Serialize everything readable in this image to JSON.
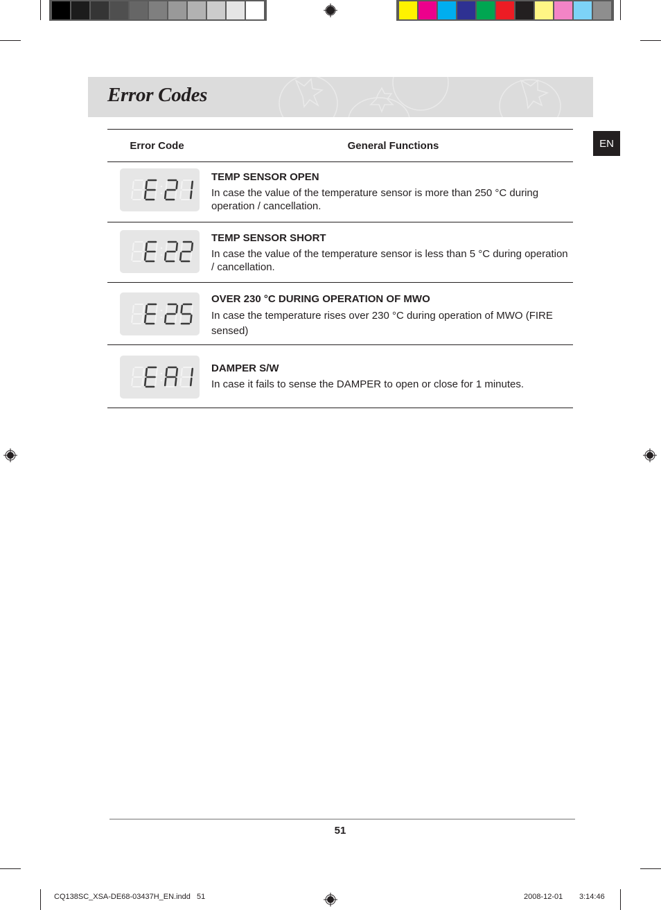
{
  "print_marks": {
    "gray_swatches": [
      "#000000",
      "#1c1c1c",
      "#353535",
      "#4f4f4f",
      "#666666",
      "#7f7f7f",
      "#999999",
      "#b2b2b2",
      "#cccccc",
      "#e5e5e5",
      "#ffffff"
    ],
    "color_swatches": [
      "#fff200",
      "#ec008c",
      "#00aeef",
      "#2e3192",
      "#00a651",
      "#ed1c24",
      "#231f20",
      "#fff685",
      "#f384c6",
      "#7dd3f7",
      "#8e8e8e"
    ]
  },
  "header": {
    "title": "Error Codes"
  },
  "language_tab": "EN",
  "table": {
    "columns": {
      "code": "Error Code",
      "functions": "General Functions"
    },
    "rows": [
      {
        "code": "E 21",
        "display_digits": [
          "E",
          "2",
          "1"
        ],
        "title": "TEMP SENSOR OPEN",
        "description": "In case the value of the temperature sensor is more than 250 °C during operation / cancellation."
      },
      {
        "code": "E 22",
        "display_digits": [
          "E",
          "2",
          "2"
        ],
        "title": "TEMP SENSOR SHORT",
        "description": "In case the value of the temperature sensor is less than 5 °C during operation / cancellation."
      },
      {
        "code": "E 25",
        "display_digits": [
          "E",
          "2",
          "5"
        ],
        "title": "OVER 230 °C DURING OPERATION OF MWO",
        "description": "In case the temperature rises over 230 °C during operation of MWO (FIRE sensed)"
      },
      {
        "code": "E A1",
        "display_digits": [
          "E",
          "A",
          "1"
        ],
        "title": "DAMPER S/W",
        "description": "In case it fails to sense the DAMPER to open or close for 1 minutes."
      }
    ]
  },
  "footer": {
    "page_number": "51",
    "slug_file": "CQ138SC_XSA-DE68-03437H_EN.indd   51",
    "slug_date": "2008-12-01",
    "slug_time": "3:14:46"
  }
}
